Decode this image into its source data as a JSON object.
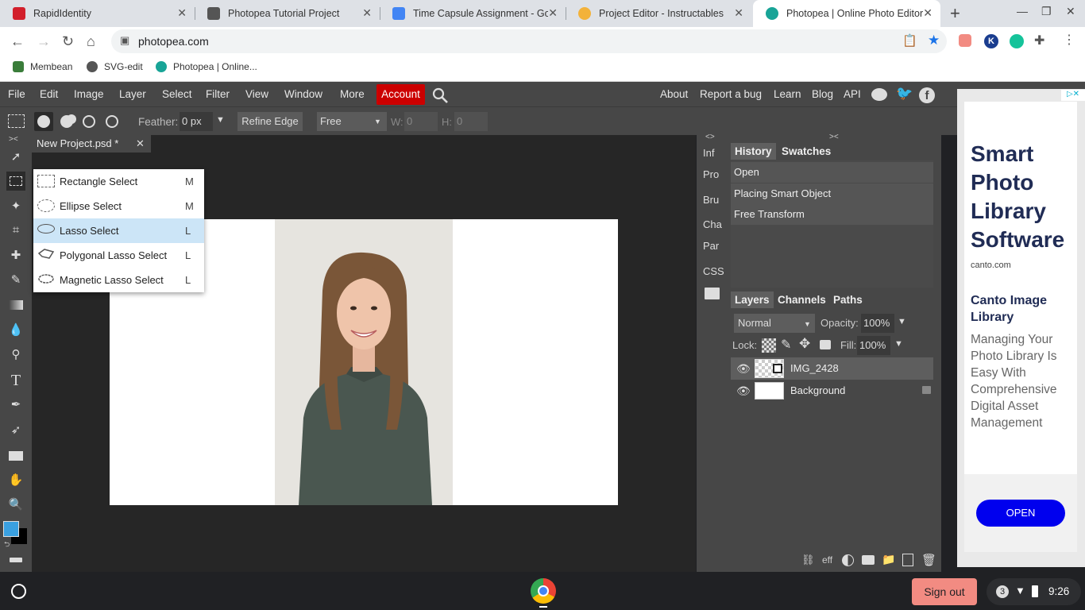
{
  "browser": {
    "tabs": [
      {
        "title": "RapidIdentity",
        "favicon_color": "#d21f2b"
      },
      {
        "title": "Photopea Tutorial Project",
        "favicon_color": "#555555"
      },
      {
        "title": "Time Capsule Assignment - Goo",
        "favicon_color": "#4285f4"
      },
      {
        "title": "Project Editor - Instructables",
        "favicon_color": "#f3b23a"
      },
      {
        "title": "Photopea | Online Photo Editor",
        "favicon_color": "#18a497"
      }
    ],
    "url": "photopea.com",
    "bookmarks": [
      {
        "label": "Membean",
        "color": "#3a7d3a"
      },
      {
        "label": "SVG-edit",
        "color": "#555555"
      },
      {
        "label": "Photopea | Online...",
        "color": "#18a497"
      }
    ],
    "new_tab": "+"
  },
  "menubar": {
    "items": [
      "File",
      "Edit",
      "Image",
      "Layer",
      "Select",
      "Filter",
      "View",
      "Window",
      "More"
    ],
    "account": "Account",
    "right_links": [
      "About",
      "Report a bug",
      "Learn",
      "Blog",
      "API"
    ]
  },
  "options": {
    "feather_label": "Feather:",
    "feather_value": "0 px",
    "refine_edge": "Refine Edge",
    "style_value": "Free",
    "w_label": "W:",
    "w_value": "0",
    "h_label": "H:",
    "h_value": "0"
  },
  "document": {
    "tab_title": "New Project.psd *"
  },
  "dropdown": {
    "items": [
      {
        "label": "Rectangle Select",
        "shortcut": "M"
      },
      {
        "label": "Ellipse Select",
        "shortcut": "M"
      },
      {
        "label": "Lasso Select",
        "shortcut": "L"
      },
      {
        "label": "Polygonal Lasso Select",
        "shortcut": "L"
      },
      {
        "label": "Magnetic Lasso Select",
        "shortcut": "L"
      }
    ],
    "selected": "Lasso Select"
  },
  "minipanel": {
    "items": [
      "Inf",
      "Pro",
      "Bru",
      "Cha",
      "Par",
      "CSS"
    ]
  },
  "history": {
    "tabs": [
      "History",
      "Swatches"
    ],
    "items": [
      "Open",
      "Placing Smart Object",
      "Free Transform"
    ]
  },
  "layers": {
    "tabs": [
      "Layers",
      "Channels",
      "Paths"
    ],
    "blend_mode": "Normal",
    "opacity_label": "Opacity:",
    "opacity": "100%",
    "lock_label": "Lock:",
    "fill_label": "Fill:",
    "fill": "100%",
    "items": [
      "IMG_2428",
      "Background"
    ],
    "footer_eff": "eff"
  },
  "ad": {
    "headline": "Smart Photo Library Software",
    "domain": "canto.com",
    "title": "Canto Image Library",
    "body": "Managing Your Photo Library Is Easy With Comprehensive Digital Asset Management",
    "cta": "OPEN"
  },
  "shelf": {
    "sign_out": "Sign out",
    "notif_count": "3",
    "time": "9:26"
  },
  "colors": {
    "foreground": "#3aa0e0",
    "background": "#000000",
    "account_red": "#cc0000",
    "cta_blue": "#0000ee",
    "signout": "#f28b82"
  }
}
